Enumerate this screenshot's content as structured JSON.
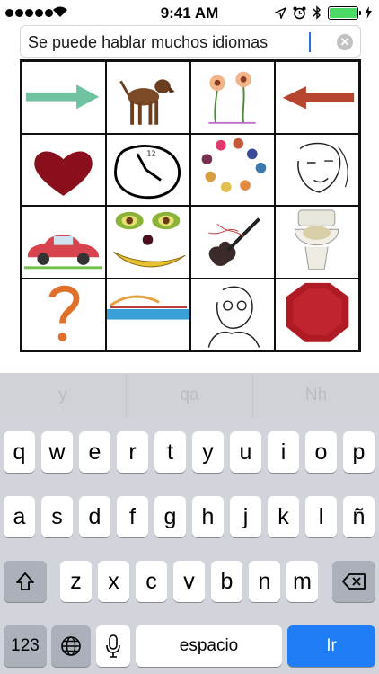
{
  "status_bar": {
    "time": "9:41 AM"
  },
  "text_field": {
    "value": "Se puede hablar muchos idiomas"
  },
  "grid": {
    "items": [
      "arrow-right",
      "dog",
      "flowers",
      "arrow-left",
      "heart",
      "clock",
      "paint-palette",
      "woman-face",
      "car",
      "banana-face",
      "guitar",
      "toilet",
      "question-mark",
      "horizon",
      "man-face",
      "red-octagon"
    ]
  },
  "keyboard": {
    "suggestions": [
      "y",
      "qa",
      "Nh"
    ],
    "row1": [
      "q",
      "w",
      "e",
      "r",
      "t",
      "y",
      "u",
      "i",
      "o",
      "p"
    ],
    "row2": [
      "a",
      "s",
      "d",
      "f",
      "g",
      "h",
      "j",
      "k",
      "l",
      "ñ"
    ],
    "row3": [
      "z",
      "x",
      "c",
      "v",
      "b",
      "n",
      "m"
    ],
    "numbers_label": "123",
    "space_label": "espacio",
    "go_label": "Ir"
  },
  "colors": {
    "accent": "#1f7ef5",
    "battery": "#4cd964",
    "caret": "#2f6fe6"
  }
}
